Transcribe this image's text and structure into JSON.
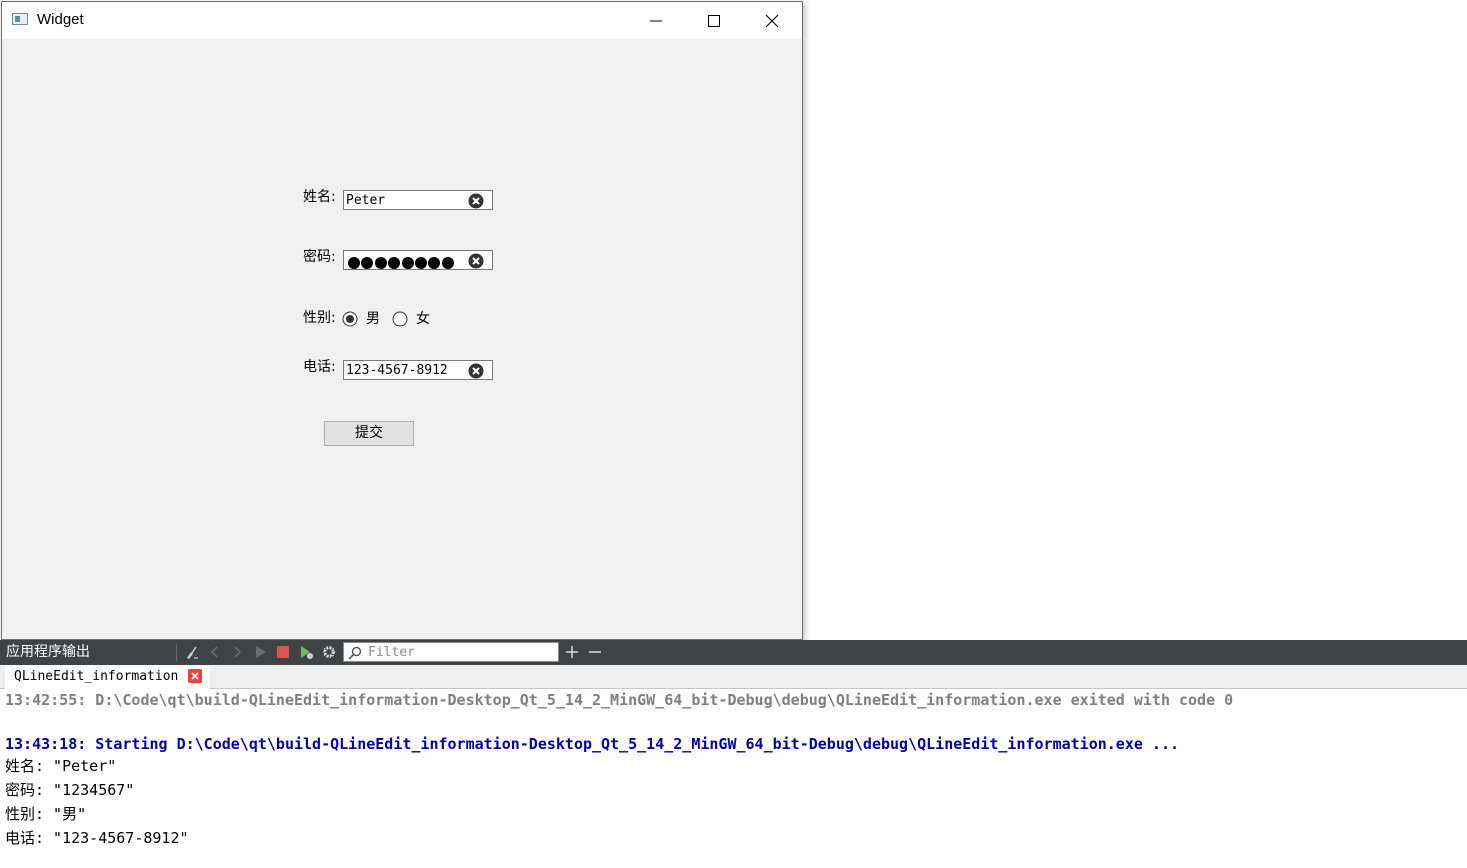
{
  "window": {
    "title": "Widget",
    "fields": {
      "name": {
        "label": "姓名:",
        "value": "Peter"
      },
      "password": {
        "label": "密码:",
        "masked_length": 8
      },
      "gender": {
        "label": "性别:",
        "options": [
          {
            "label": "男",
            "checked": true
          },
          {
            "label": "女",
            "checked": false
          }
        ]
      },
      "phone": {
        "label": "电话:",
        "value": "123-4567-8912"
      }
    },
    "submit_label": "提交"
  },
  "output_pane": {
    "title": "应用程序输出",
    "filter_placeholder": "Filter",
    "tab_label": "QLineEdit_information",
    "lines": [
      {
        "text": "13:42:55: D:\\Code\\qt\\build-QLineEdit_information-Desktop_Qt_5_14_2_MinGW_64_bit-Debug\\debug\\QLineEdit_information.exe exited with code 0",
        "style": "gray"
      },
      {
        "text": "13:43:18: Starting D:\\Code\\qt\\build-QLineEdit_information-Desktop_Qt_5_14_2_MinGW_64_bit-Debug\\debug\\QLineEdit_information.exe ...",
        "style": "blue"
      },
      {
        "text": "姓名: \"Peter\"",
        "style": "black"
      },
      {
        "text": "密码: \"1234567\"",
        "style": "black"
      },
      {
        "text": "性别: \"男\"",
        "style": "black"
      },
      {
        "text": "电话: \"123-4567-8912\"",
        "style": "black"
      }
    ]
  },
  "colors": {
    "output_gray": "#7f7f7f",
    "output_blue": "#0000aa",
    "toolbar_bg": "#404244",
    "stop_red": "#d9534f",
    "tab_close_red": "#e8453c"
  },
  "icons": [
    "app-icon",
    "minimize-icon",
    "maximize-icon",
    "close-icon",
    "clear-text-icon",
    "clean-icon",
    "prev-icon",
    "next-icon",
    "run-icon",
    "stop-icon",
    "attach-icon",
    "settings-icon",
    "search-icon",
    "zoom-in-icon",
    "zoom-out-icon",
    "tab-close-icon"
  ]
}
